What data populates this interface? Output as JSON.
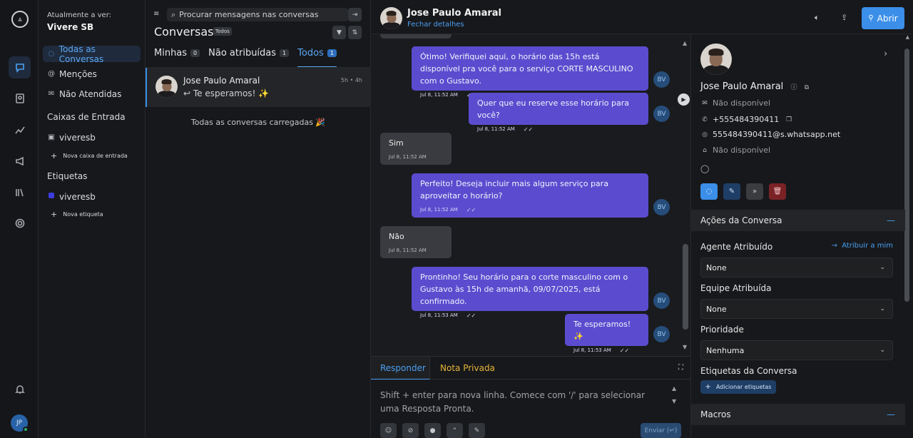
{
  "app": {
    "viewing_label": "Atualmente a ver:",
    "workspace": "Vivere SB"
  },
  "rail": {
    "avatar_initials": "JP"
  },
  "sidebar": {
    "items": [
      {
        "label": "Todas as Conversas",
        "icon": "chat-icon"
      },
      {
        "label": "Menções",
        "icon": "at-icon"
      },
      {
        "label": "Não Atendidas",
        "icon": "inbox-icon"
      }
    ],
    "inboxes_title": "Caixas de Entrada",
    "inbox_item": "viveresb",
    "new_inbox": "Nova caixa de entrada",
    "labels_title": "Etiquetas",
    "label_item": "viveresb",
    "label_color": "#3b3be0",
    "new_label": "Nova etiqueta"
  },
  "list": {
    "search_placeholder": "Procurar mensagens nas conversas",
    "title": "Conversas",
    "filter_badge": "Todos",
    "tabs": [
      {
        "label": "Minhas",
        "count": "0"
      },
      {
        "label": "Não atribuídas",
        "count": "1"
      },
      {
        "label": "Todos",
        "count": "1"
      }
    ],
    "conversation": {
      "name": "Jose Paulo Amaral",
      "time": "5h • 4h",
      "preview": "↩ Te esperamos! ✨"
    },
    "loaded_text": "Todas as conversas carregadas 🎉"
  },
  "chat": {
    "contact_name": "Jose Paulo Amaral",
    "close_details": "Fechar detalhes",
    "open_button": "Abrir",
    "messages": [
      {
        "dir": "out",
        "text": "Ótimo! Verifiquei aqui, o horário das 15h está disponível pra você para o serviço CORTE MASCULINO com o Gustavo.",
        "time": "Jul 8, 11:52 AM",
        "avatar": "BV"
      },
      {
        "dir": "out",
        "text": "Quer que eu reserve esse horário para você?",
        "time": "Jul 8, 11:52 AM",
        "avatar": "BV"
      },
      {
        "dir": "in",
        "text": "Sim",
        "time": "Jul 8, 11:52 AM"
      },
      {
        "dir": "out",
        "text": "Perfeito! Deseja incluir mais algum serviço para aproveitar o horário?",
        "time": "Jul 8, 11:52 AM",
        "avatar": "BV"
      },
      {
        "dir": "in",
        "text": "Não",
        "time": "Jul 8, 11:52 AM"
      },
      {
        "dir": "out",
        "text": "Prontinho! Seu horário para o corte masculino com o Gustavo às 15h de amanhã, 09/07/2025, está confirmado.",
        "time": "Jul 8, 11:53 AM",
        "avatar": "BV"
      },
      {
        "dir": "out",
        "text": "Te esperamos! ✨",
        "time": "Jul 8, 11:53 AM",
        "avatar": "BV"
      }
    ],
    "composer": {
      "reply_tab": "Responder",
      "private_tab": "Nota Privada",
      "placeholder": "Shift + enter para nova linha. Comece com '/' para selecionar uma Resposta Pronta.",
      "send": "Enviar (↵)"
    }
  },
  "panel": {
    "name": "Jose Paulo Amaral",
    "email": "Não disponível",
    "phone": "+555484390411",
    "identifier": "555484390411@s.whatsapp.net",
    "company": "Não disponível",
    "actions_title": "Ações da Conversa",
    "agent_label": "Agente Atribuído",
    "assign_me": "Atribuir a mim",
    "agent_value": "None",
    "team_label": "Equipe Atribuída",
    "team_value": "None",
    "priority_label": "Prioridade",
    "priority_value": "Nenhuma",
    "tags_label": "Etiquetas da Conversa",
    "add_tags": "Adicionar etiquetas",
    "macros_title": "Macros"
  }
}
